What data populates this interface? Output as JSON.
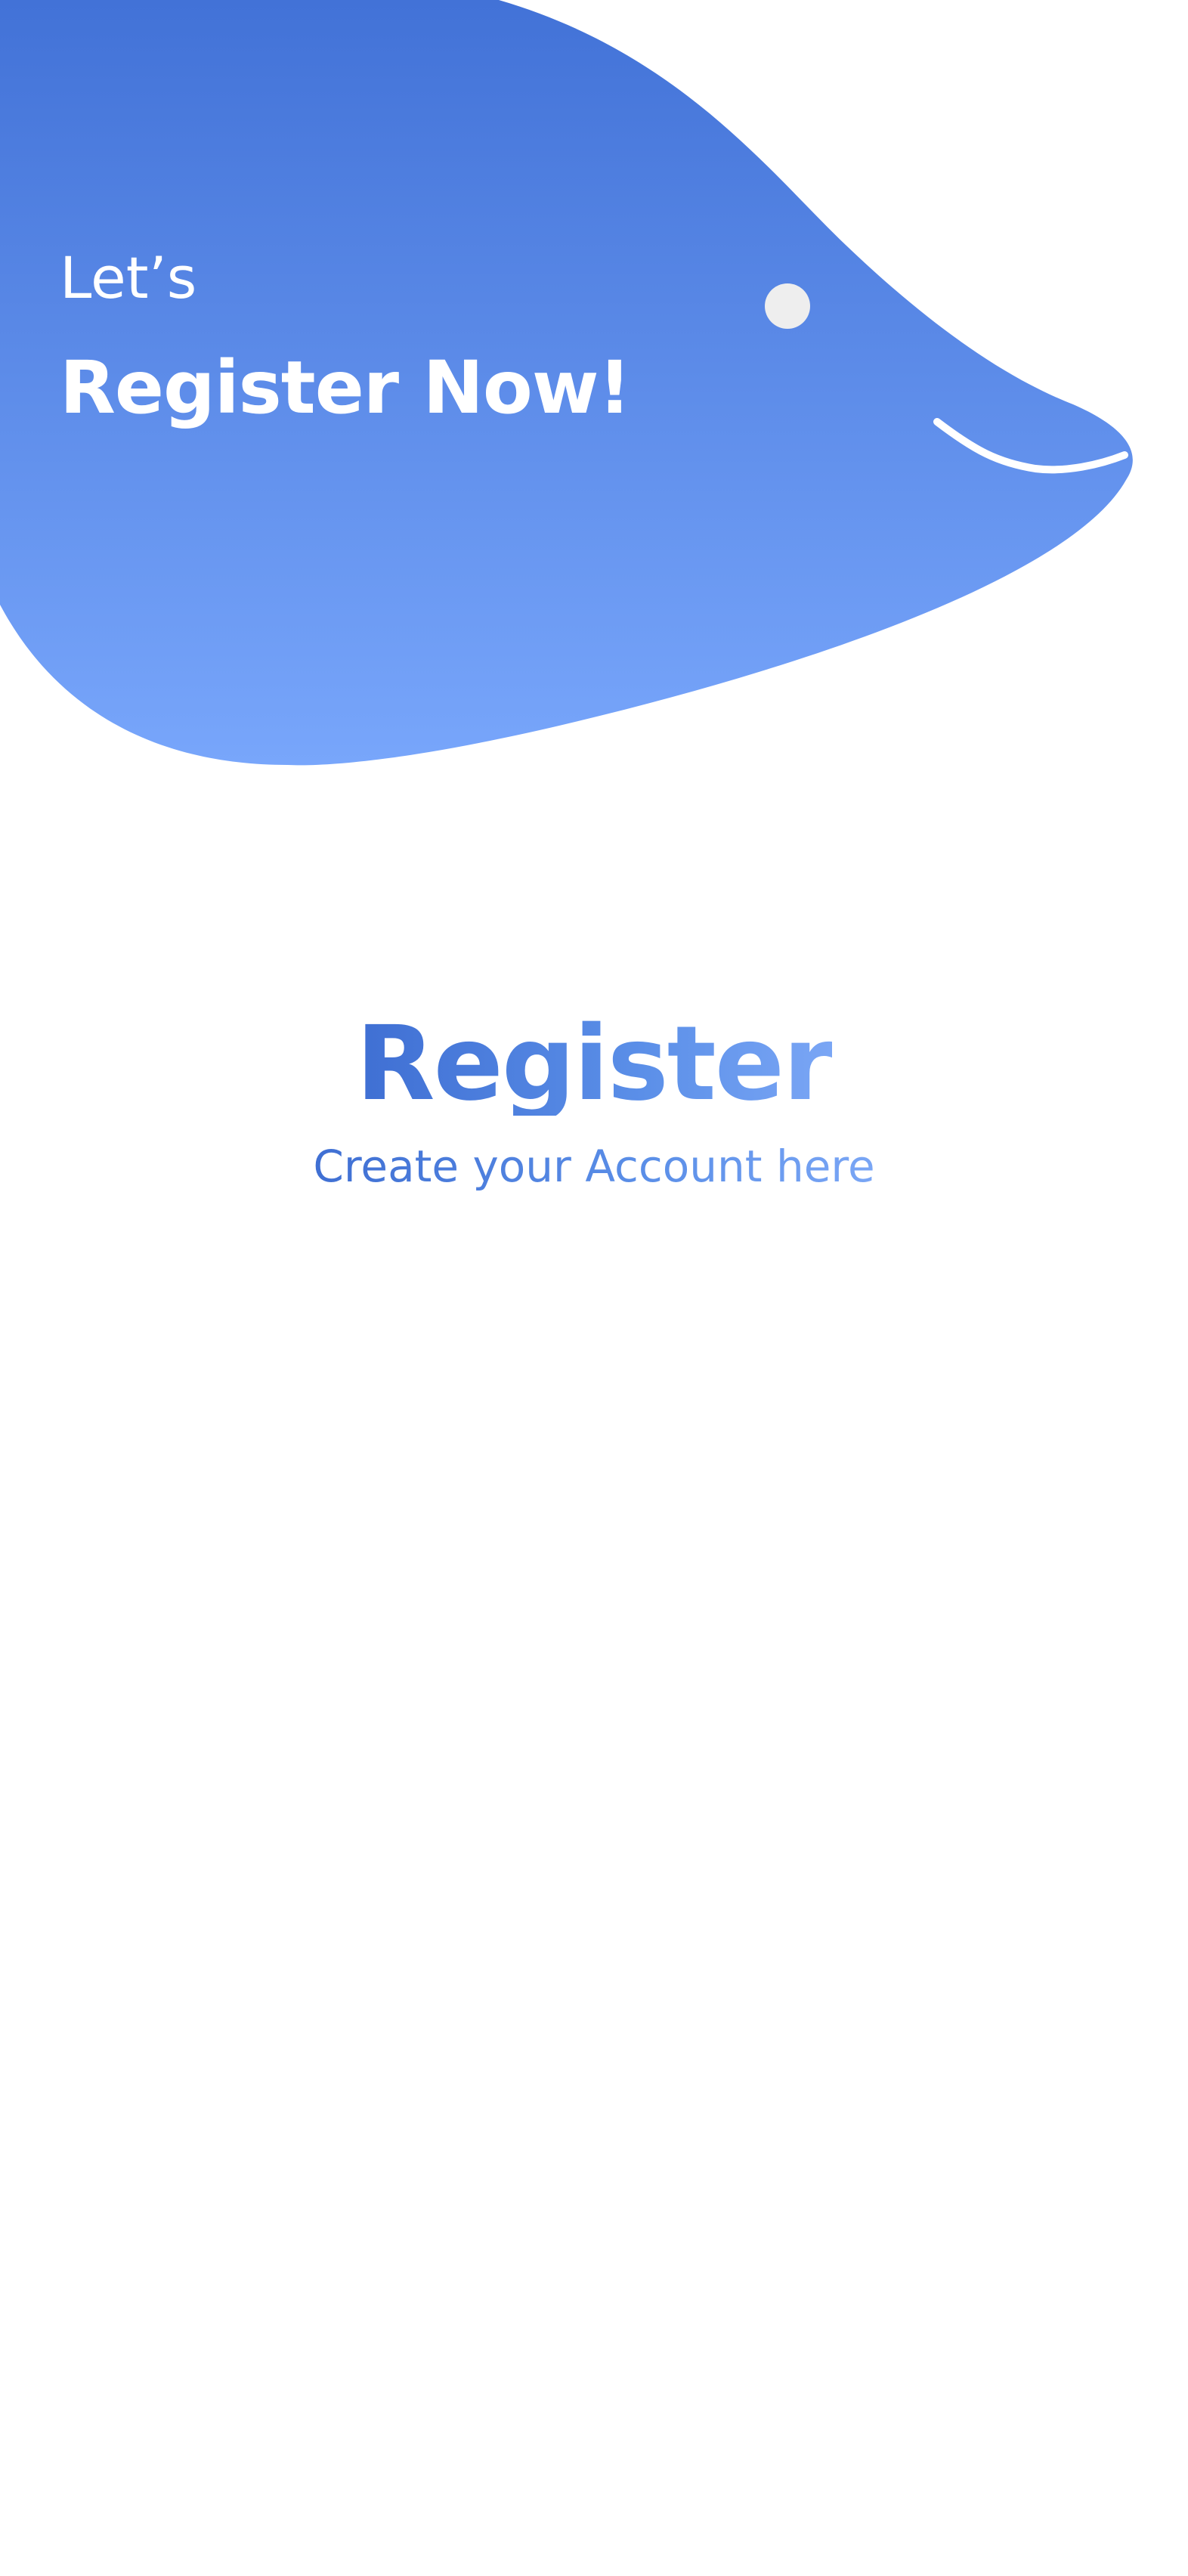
{
  "colors": {
    "blob_top": "#4272d7",
    "blob_bottom": "#78a6fb",
    "eye": "#eeeeee",
    "text_on_blob": "#ffffff",
    "title_gradient_start": "#3f6fd3",
    "title_gradient_end": "#7aa6f5",
    "background": "#ffffff"
  },
  "hero": {
    "subtitle": "Let’s",
    "title": "Register Now!",
    "decoration": "blue-blob-mascot"
  },
  "main": {
    "title": "Register",
    "subtitle": "Create your Account here"
  }
}
